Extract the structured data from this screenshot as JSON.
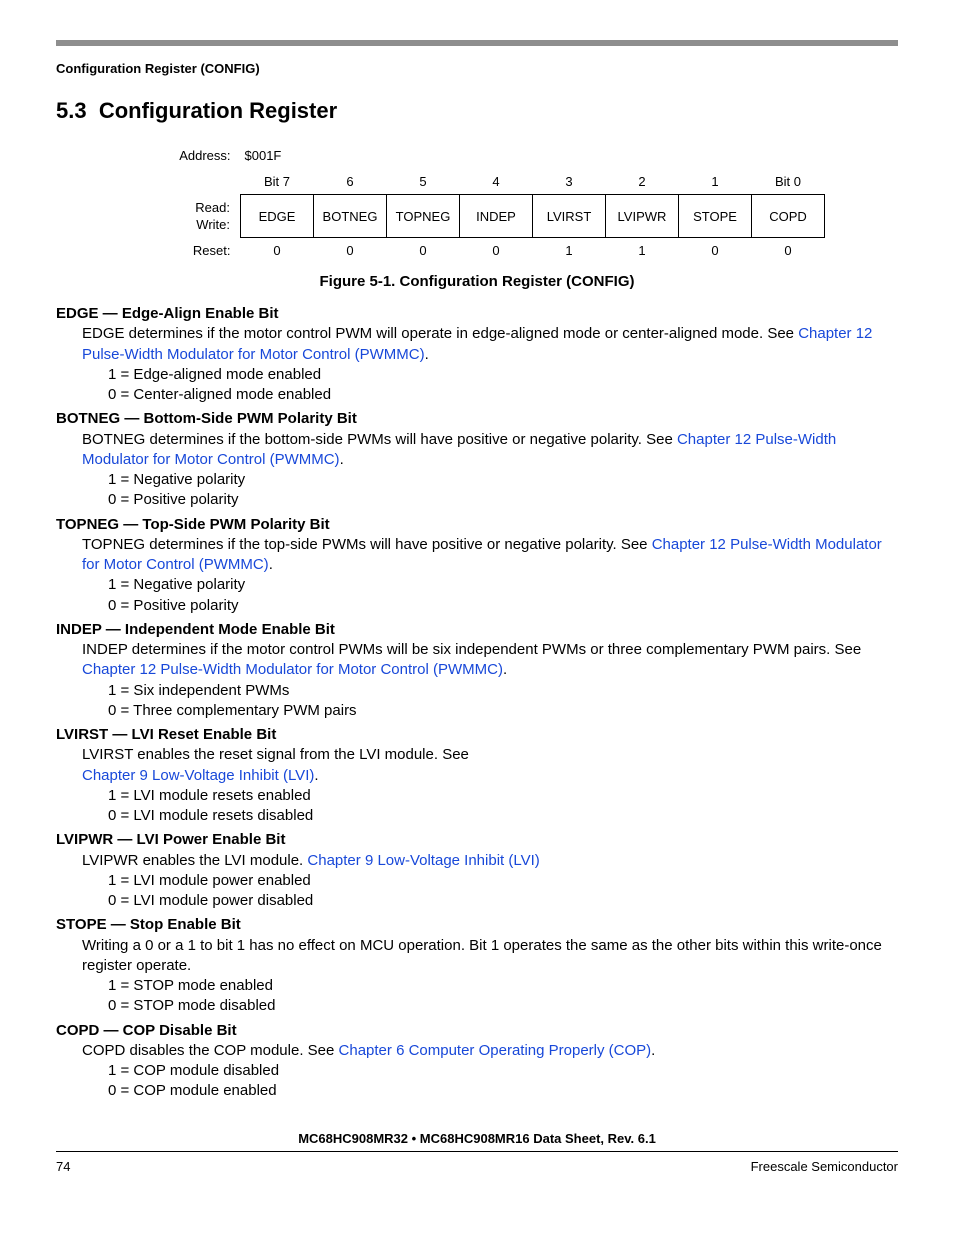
{
  "runningHeader": "Configuration Register (CONFIG)",
  "sectionNumber": "5.3",
  "sectionTitle": "Configuration Register",
  "register": {
    "addressLabel": "Address:",
    "address": "$001F",
    "bitHeaders": [
      "Bit 7",
      "6",
      "5",
      "4",
      "3",
      "2",
      "1",
      "Bit 0"
    ],
    "readLabel": "Read:",
    "writeLabel": "Write:",
    "bits": [
      "EDGE",
      "BOTNEG",
      "TOPNEG",
      "INDEP",
      "LVIRST",
      "LVIPWR",
      "STOPE",
      "COPD"
    ],
    "resetLabel": "Reset:",
    "reset": [
      "0",
      "0",
      "0",
      "0",
      "1",
      "1",
      "0",
      "0"
    ]
  },
  "caption": "Figure 5-1. Configuration Register (CONFIG)",
  "fields": [
    {
      "title": "EDGE — Edge-Align Enable Bit",
      "descPre": "EDGE determines if the motor control PWM will operate in edge-aligned mode or center-aligned mode. See ",
      "link": "Chapter 12 Pulse-Width Modulator for Motor Control (PWMMC)",
      "descPost": ".",
      "vals": [
        "1 = Edge-aligned mode enabled",
        "0 = Center-aligned mode enabled"
      ]
    },
    {
      "title": "BOTNEG — Bottom-Side PWM Polarity Bit",
      "descPre": "BOTNEG determines if the bottom-side PWMs will have positive or negative polarity. See ",
      "link": "Chapter 12 Pulse-Width Modulator for Motor Control (PWMMC)",
      "descPost": ".",
      "vals": [
        "1 = Negative polarity",
        "0 = Positive polarity"
      ]
    },
    {
      "title": "TOPNEG — Top-Side PWM Polarity Bit",
      "descPre": "TOPNEG determines if the top-side PWMs will have positive or negative polarity. See ",
      "link": "Chapter 12 Pulse-Width Modulator for Motor Control (PWMMC)",
      "descPost": ".",
      "vals": [
        "1 = Negative polarity",
        "0 = Positive polarity"
      ]
    },
    {
      "title": "INDEP — Independent Mode Enable Bit",
      "descPre": "INDEP determines if the motor control PWMs will be six independent PWMs or three complementary PWM pairs. See ",
      "link": "Chapter 12 Pulse-Width Modulator for Motor Control (PWMMC)",
      "descPost": ".",
      "vals": [
        "1 = Six independent PWMs",
        "0 = Three complementary PWM pairs"
      ]
    },
    {
      "title": "LVIRST — LVI Reset Enable Bit",
      "descPre": "LVIRST enables the reset signal from the LVI module. See ",
      "link": "Chapter 9 Low-Voltage Inhibit (LVI)",
      "descPost": ".",
      "linkOnNewLine": true,
      "vals": [
        "1 = LVI module resets enabled",
        "0 = LVI module resets disabled"
      ]
    },
    {
      "title": "LVIPWR — LVI Power Enable Bit",
      "descPre": "LVIPWR enables the LVI module. ",
      "link": "Chapter 9 Low-Voltage Inhibit (LVI)",
      "descPost": "",
      "vals": [
        "1 = LVI module power enabled",
        "0 = LVI module power disabled"
      ]
    },
    {
      "title": "STOPE — Stop Enable Bit",
      "descPre": "Writing a 0 or a 1 to bit 1 has no effect on MCU operation. Bit 1 operates the same as the other bits within this write-once register operate.",
      "link": "",
      "descPost": "",
      "vals": [
        "1 = STOP mode enabled",
        "0 = STOP mode disabled"
      ]
    },
    {
      "title": "COPD — COP Disable Bit",
      "descPre": "COPD disables the COP module. See ",
      "link": "Chapter 6 Computer Operating Properly (COP)",
      "descPost": ".",
      "vals": [
        "1 = COP module disabled",
        "0 = COP module enabled"
      ]
    }
  ],
  "footerDoc": "MC68HC908MR32 • MC68HC908MR16 Data Sheet, Rev. 6.1",
  "pageNumber": "74",
  "publisher": "Freescale Semiconductor"
}
